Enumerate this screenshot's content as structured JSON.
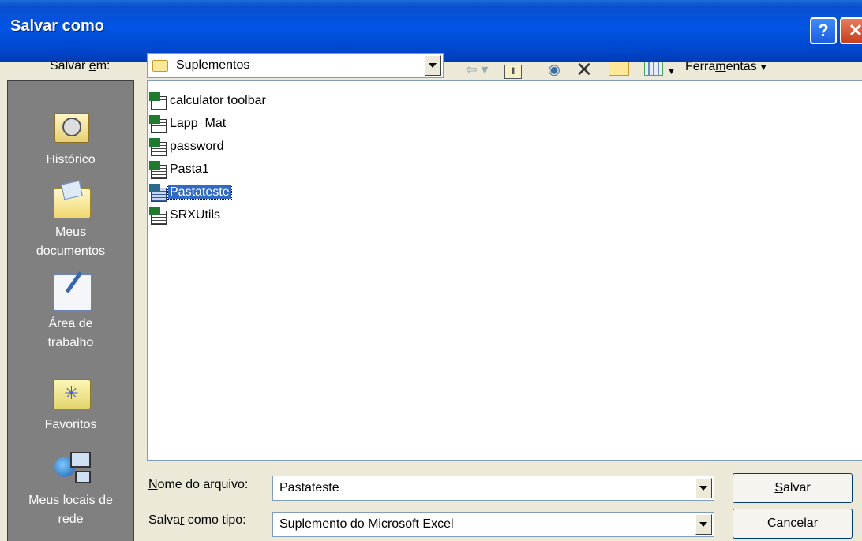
{
  "window": {
    "title": "Salvar como"
  },
  "location": {
    "label_prefix": "Salvar ",
    "label_accel": "e",
    "label_suffix": "m:",
    "value": "Suplementos"
  },
  "toolbar": {
    "tools_prefix": "Ferra",
    "tools_accel": "m",
    "tools_suffix": "entas"
  },
  "places": [
    {
      "label": "Histórico"
    },
    {
      "label": "Meus documentos"
    },
    {
      "label": "Área de trabalho"
    },
    {
      "label": "Favoritos"
    },
    {
      "label": "Meus locais de rede"
    }
  ],
  "files": [
    {
      "name": "calculator toolbar"
    },
    {
      "name": "Lapp_Mat"
    },
    {
      "name": "password"
    },
    {
      "name": "Pasta1"
    },
    {
      "name": "Pastateste"
    },
    {
      "name": "SRXUtils"
    }
  ],
  "filename": {
    "label_accel": "N",
    "label_rest": "ome do arquivo:",
    "value": "Pastateste"
  },
  "filetype": {
    "label_prefix": "Salva",
    "label_accel": "r",
    "label_suffix": " como tipo:",
    "value": "Suplemento do Microsoft Excel"
  },
  "buttons": {
    "save_accel": "S",
    "save_rest": "alvar",
    "cancel": "Cancelar"
  },
  "colors": {
    "title_bar": "#0055e5",
    "selection": "#316ac5",
    "sidebar": "#808080",
    "dialog": "#ece9d8"
  },
  "icons": [
    "help-icon",
    "close-icon",
    "folder-icon",
    "back-icon",
    "up-folder-icon",
    "search-web-icon",
    "delete-icon",
    "new-folder-icon",
    "views-icon",
    "history-icon",
    "my-documents-icon",
    "desktop-icon",
    "favorites-icon",
    "network-places-icon",
    "excel-addin-icon"
  ]
}
